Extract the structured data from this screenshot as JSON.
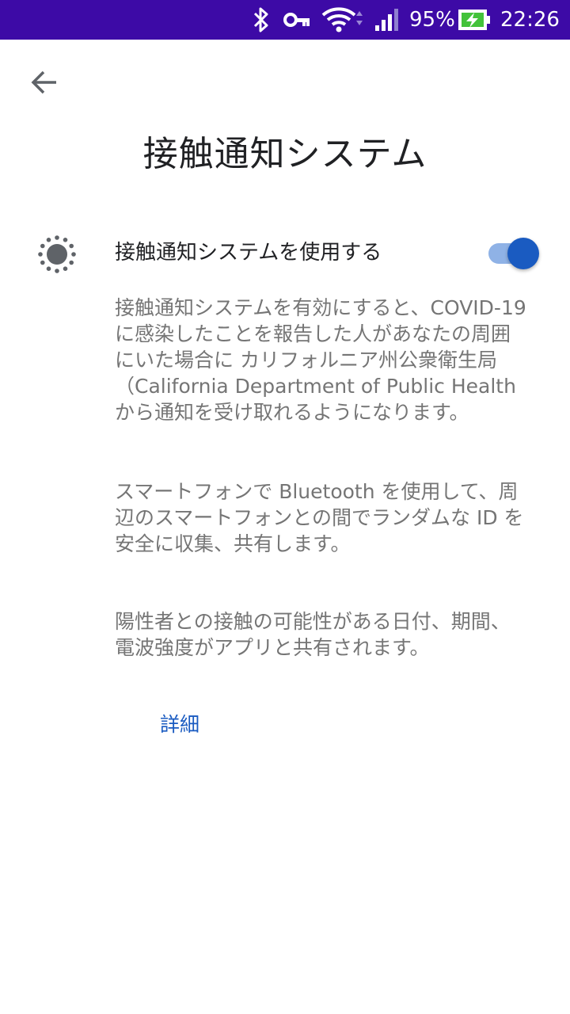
{
  "status_bar": {
    "battery_percent": "95%",
    "time": "22:26",
    "icons": [
      "bluetooth-icon",
      "vpn-key-icon",
      "wifi-icon",
      "signal-icon",
      "battery-charging-icon"
    ],
    "background_color": "#3d0aa6"
  },
  "header": {
    "back_icon": "arrow-back-icon",
    "title": "接触通知システム"
  },
  "setting": {
    "icon": "exposure-notification-icon",
    "label": "接触通知システムを使用する",
    "enabled": true,
    "accent_color": "#1a5bc1"
  },
  "description": {
    "paragraph_1": "接触通知システムを有効にすると、COVID-19 に感染したことを報告した人があなたの周囲にいた場合に カリフォルニア州公衆衛生局（California Department of Public Health から通知を受け取れるようになります。",
    "paragraph_2": "スマートフォンで Bluetooth を使用して、周辺のスマートフォンとの間でランダムな ID を安全に収集、共有します。",
    "paragraph_3": "陽性者との接触の可能性がある日付、期間、電波強度がアプリと共有されます。"
  },
  "details_link": "詳細"
}
